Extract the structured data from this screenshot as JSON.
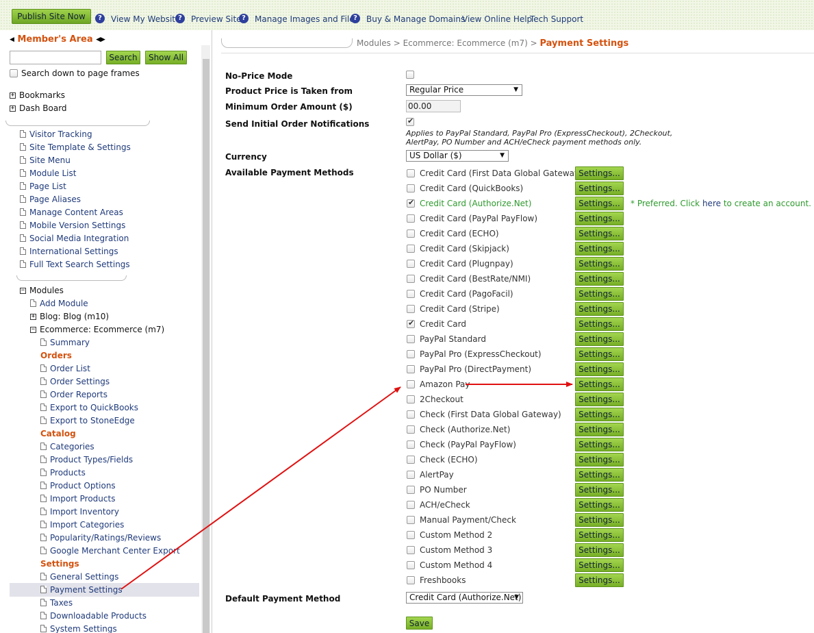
{
  "topbar": {
    "publish": "Publish Site Now",
    "links": [
      "View My Website",
      "Preview Site",
      "Manage Images and Files",
      "Buy & Manage Domains",
      "View Online Help",
      "Tech Support"
    ]
  },
  "sidebar": {
    "title": "Member's Area",
    "search_value": "",
    "search_btn": "Search",
    "show_all_btn": "Show All",
    "search_frames": "Search down to page frames",
    "bookmarks": "Bookmarks",
    "dashboard": "Dash Board",
    "site_items": [
      "Visitor Tracking",
      "Site Template & Settings",
      "Site Menu",
      "Module List",
      "Page List",
      "Page Aliases",
      "Manage Content Areas",
      "Mobile Version Settings",
      "Social Media Integration",
      "International Settings",
      "Full Text Search Settings"
    ],
    "modules": "Modules",
    "add_module": "Add Module",
    "blog": "Blog: Blog (m10)",
    "ecommerce": "Ecommerce: Ecommerce (m7)",
    "summary": "Summary",
    "orders_heading": "Orders",
    "orders_items": [
      "Order List",
      "Order Settings",
      "Order Reports",
      "Export to QuickBooks",
      "Export to StoneEdge"
    ],
    "catalog_heading": "Catalog",
    "catalog_items": [
      "Categories",
      "Product Types/Fields",
      "Products",
      "Product Options",
      "Import Products",
      "Import Inventory",
      "Import Categories",
      "Popularity/Ratings/Reviews",
      "Google Merchant Center Export"
    ],
    "settings_heading": "Settings",
    "settings_items": [
      "General Settings",
      "Payment Settings",
      "Taxes",
      "Downloadable Products",
      "System Settings"
    ]
  },
  "breadcrumb": {
    "path": "Modules > Ecommerce: Ecommerce (m7) >",
    "current": "Payment Settings"
  },
  "form": {
    "no_price_label": "No-Price Mode",
    "no_price_checked": false,
    "price_from_label": "Product Price is Taken from",
    "price_from_value": "Regular Price",
    "min_order_label": "Minimum Order Amount ($)",
    "min_order_value": "00.00",
    "send_notif_label": "Send Initial Order Notifications",
    "send_notif_checked": true,
    "send_notif_note": "Applies to PayPal Standard, PayPal Pro (ExpressCheckout), 2Checkout, AlertPay, PO Number and ACH/eCheck payment methods only.",
    "currency_label": "Currency",
    "currency_value": "US Dollar ($)",
    "methods_label": "Available Payment Methods",
    "settings_btn": "Settings...",
    "preferred_note": "* Preferred. Click",
    "preferred_link": "here",
    "preferred_tail": "to create an account.",
    "methods": [
      {
        "name": "Credit Card (First Data Global Gateway)",
        "checked": false
      },
      {
        "name": "Credit Card (QuickBooks)",
        "checked": false
      },
      {
        "name": "Credit Card (Authorize.Net)",
        "checked": true
      },
      {
        "name": "Credit Card (PayPal PayFlow)",
        "checked": false
      },
      {
        "name": "Credit Card (ECHO)",
        "checked": false
      },
      {
        "name": "Credit Card (Skipjack)",
        "checked": false
      },
      {
        "name": "Credit Card (Plugnpay)",
        "checked": false
      },
      {
        "name": "Credit Card (BestRate/NMI)",
        "checked": false
      },
      {
        "name": "Credit Card (PagoFacil)",
        "checked": false
      },
      {
        "name": "Credit Card (Stripe)",
        "checked": false
      },
      {
        "name": "Credit Card",
        "checked": true
      },
      {
        "name": "PayPal Standard",
        "checked": false
      },
      {
        "name": "PayPal Pro (ExpressCheckout)",
        "checked": false
      },
      {
        "name": "PayPal Pro (DirectPayment)",
        "checked": false
      },
      {
        "name": "Amazon Pay",
        "checked": false
      },
      {
        "name": "2Checkout",
        "checked": false
      },
      {
        "name": "Check (First Data Global Gateway)",
        "checked": false
      },
      {
        "name": "Check (Authorize.Net)",
        "checked": false
      },
      {
        "name": "Check (PayPal PayFlow)",
        "checked": false
      },
      {
        "name": "Check (ECHO)",
        "checked": false
      },
      {
        "name": "AlertPay",
        "checked": false
      },
      {
        "name": "PO Number",
        "checked": false
      },
      {
        "name": "ACH/eCheck",
        "checked": false
      },
      {
        "name": "Manual Payment/Check",
        "checked": false
      },
      {
        "name": "Custom Method 2",
        "checked": false
      },
      {
        "name": "Custom Method 3",
        "checked": false
      },
      {
        "name": "Custom Method 4",
        "checked": false
      },
      {
        "name": "Freshbooks",
        "checked": false
      }
    ],
    "default_method_label": "Default Payment Method",
    "default_method_value": "Credit Card (Authorize.Net)",
    "save": "Save"
  },
  "colors": {
    "accent": "#d4520f",
    "green_button": "#8cc43c",
    "annotation_arrow": "#e01010"
  }
}
